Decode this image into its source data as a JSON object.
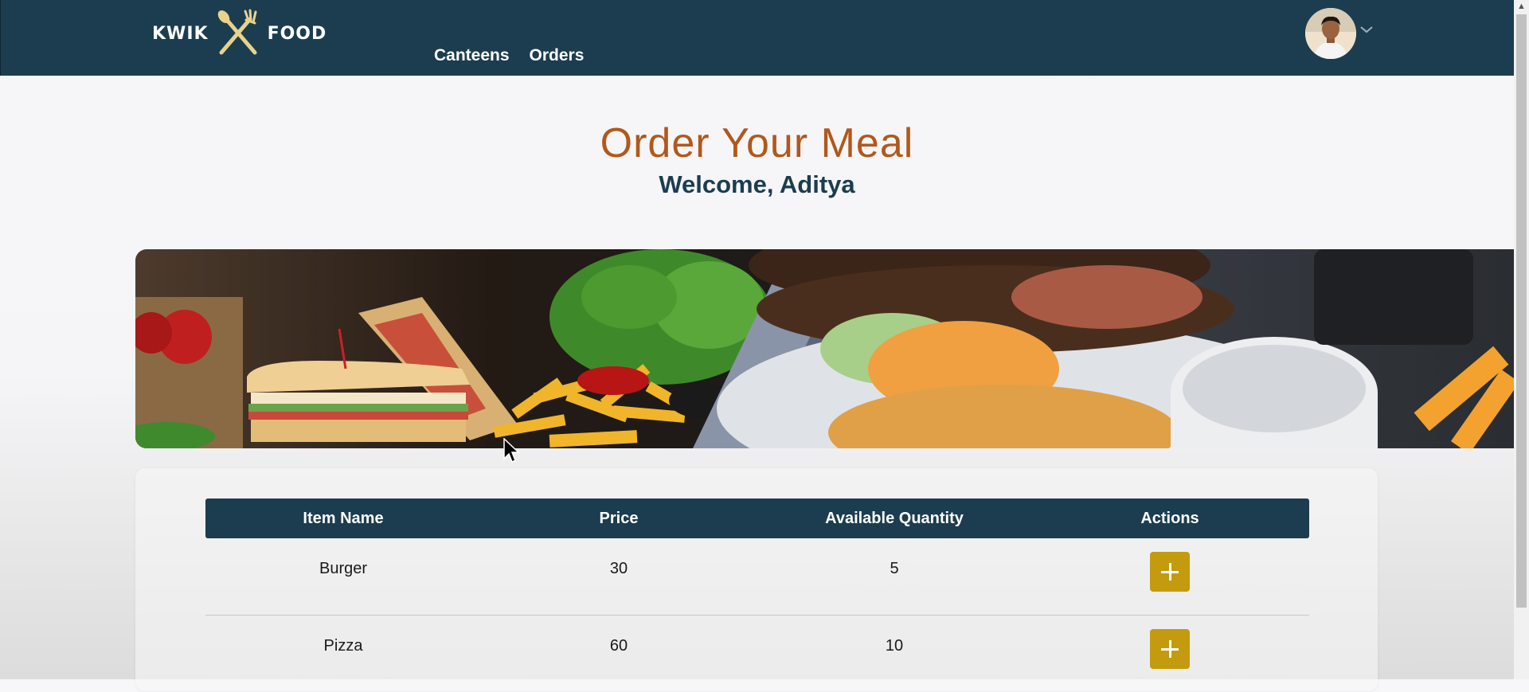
{
  "brand": {
    "left": "KWIK",
    "right": "FOOD"
  },
  "nav": {
    "items": [
      {
        "label": "Canteens"
      },
      {
        "label": "Orders"
      }
    ]
  },
  "header": {
    "title": "Order Your Meal",
    "welcome": "Welcome, Aditya"
  },
  "table": {
    "headers": [
      "Item Name",
      "Price",
      "Available Quantity",
      "Actions"
    ],
    "rows": [
      {
        "name": "Burger",
        "price": "30",
        "quantity": "5"
      },
      {
        "name": "Pizza",
        "price": "60",
        "quantity": "10"
      }
    ]
  },
  "colors": {
    "navbar": "#1b3d4f",
    "title": "#b1581c",
    "subtitle": "#1b3d4f",
    "add_button": "#c49a0e"
  },
  "icons": {
    "logo": "fork-spoon-cross-icon",
    "profile": "user-avatar",
    "dropdown": "chevron-down-icon",
    "add": "plus-icon",
    "cursor": "mouse-pointer-icon"
  }
}
